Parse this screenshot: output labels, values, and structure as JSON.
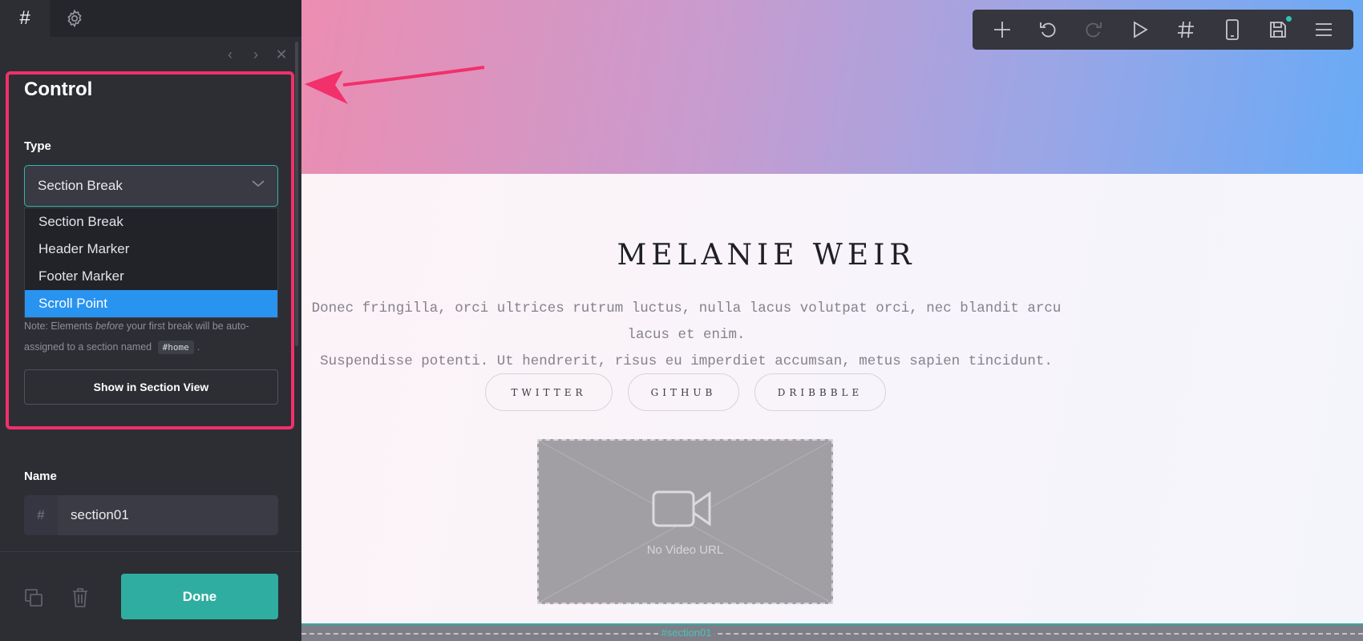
{
  "sidebar": {
    "tabs": [
      {
        "id": "sections",
        "icon": "hash-icon",
        "label": "#"
      },
      {
        "id": "settings",
        "icon": "gear-icon"
      }
    ],
    "panel": {
      "title": "Control",
      "type_label": "Type",
      "type_value": "Section Break",
      "type_options": [
        "Section Break",
        "Header Marker",
        "Footer Marker",
        "Scroll Point"
      ],
      "highlighted_option": "Scroll Point",
      "note_prefix": "Note: Elements ",
      "note_emph": "before",
      "note_middle": " your first break will be auto-assigned to a section named ",
      "note_code": "#home",
      "note_suffix": ".",
      "show_button": "Show in Section View",
      "name_label": "Name",
      "name_prefix": "#",
      "name_value": "section01",
      "done_button": "Done"
    }
  },
  "toolbar": {
    "buttons": [
      "plus-icon",
      "undo-icon",
      "redo-icon",
      "play-icon",
      "hash-icon",
      "mobile-icon",
      "save-icon",
      "menu-icon"
    ]
  },
  "canvas": {
    "name": "MELANIE WEIR",
    "text_line1": "Donec fringilla, orci ultrices rutrum luctus, nulla lacus volutpat orci, nec blandit arcu lacus et enim.",
    "text_line2": "Suspendisse potenti. Ut hendrerit, risus eu imperdiet accumsan, metus sapien tincidunt.",
    "socials": [
      "TWITTER",
      "GITHUB",
      "DRIBBBLE"
    ],
    "video_label": "No Video URL",
    "section_tag": "#section01"
  },
  "colors": {
    "accent": "#2fada0",
    "highlight": "#f2306b",
    "selected_option": "#2993f0"
  }
}
